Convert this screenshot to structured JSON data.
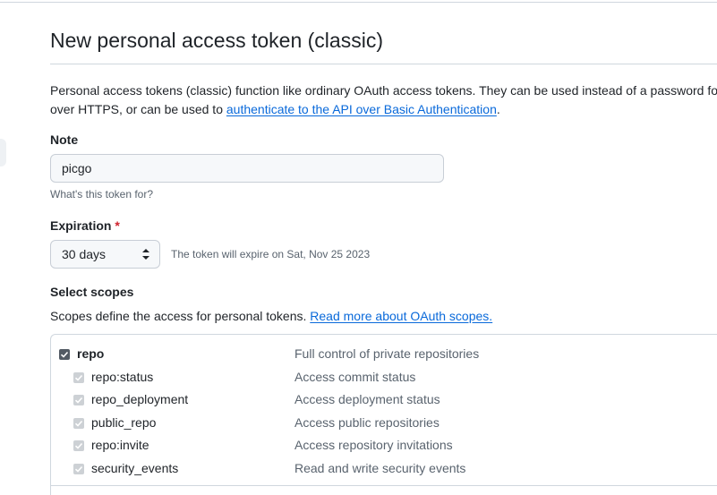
{
  "header": {
    "title": "New personal access token (classic)"
  },
  "description": {
    "line1": "Personal access tokens (classic) function like ordinary OAuth access tokens. They can be used instead of a password for G",
    "line2_prefix": "over HTTPS, or can be used to ",
    "link_text": "authenticate to the API over Basic Authentication",
    "line2_suffix": "."
  },
  "note": {
    "label": "Note",
    "value": "picgo",
    "hint": "What's this token for?"
  },
  "expiration": {
    "label": "Expiration",
    "required_mark": "*",
    "selected": "30 days",
    "expiry_text": "The token will expire on Sat, Nov 25 2023"
  },
  "scopes": {
    "label": "Select scopes",
    "description": "Scopes define the access for personal tokens. ",
    "link_text": "Read more about OAuth scopes.",
    "main": {
      "name": "repo",
      "description": "Full control of private repositories",
      "checked": true
    },
    "items": [
      {
        "name": "repo:status",
        "description": "Access commit status",
        "checked": true
      },
      {
        "name": "repo_deployment",
        "description": "Access deployment status",
        "checked": true
      },
      {
        "name": "public_repo",
        "description": "Access public repositories",
        "checked": true
      },
      {
        "name": "repo:invite",
        "description": "Access repository invitations",
        "checked": true
      },
      {
        "name": "security_events",
        "description": "Read and write security events",
        "checked": true
      }
    ]
  },
  "colors": {
    "link": "#0969da",
    "required": "#cf222e",
    "checkbox_checked": "#525a63",
    "checkbox_disabled": "#cdd1d5"
  }
}
